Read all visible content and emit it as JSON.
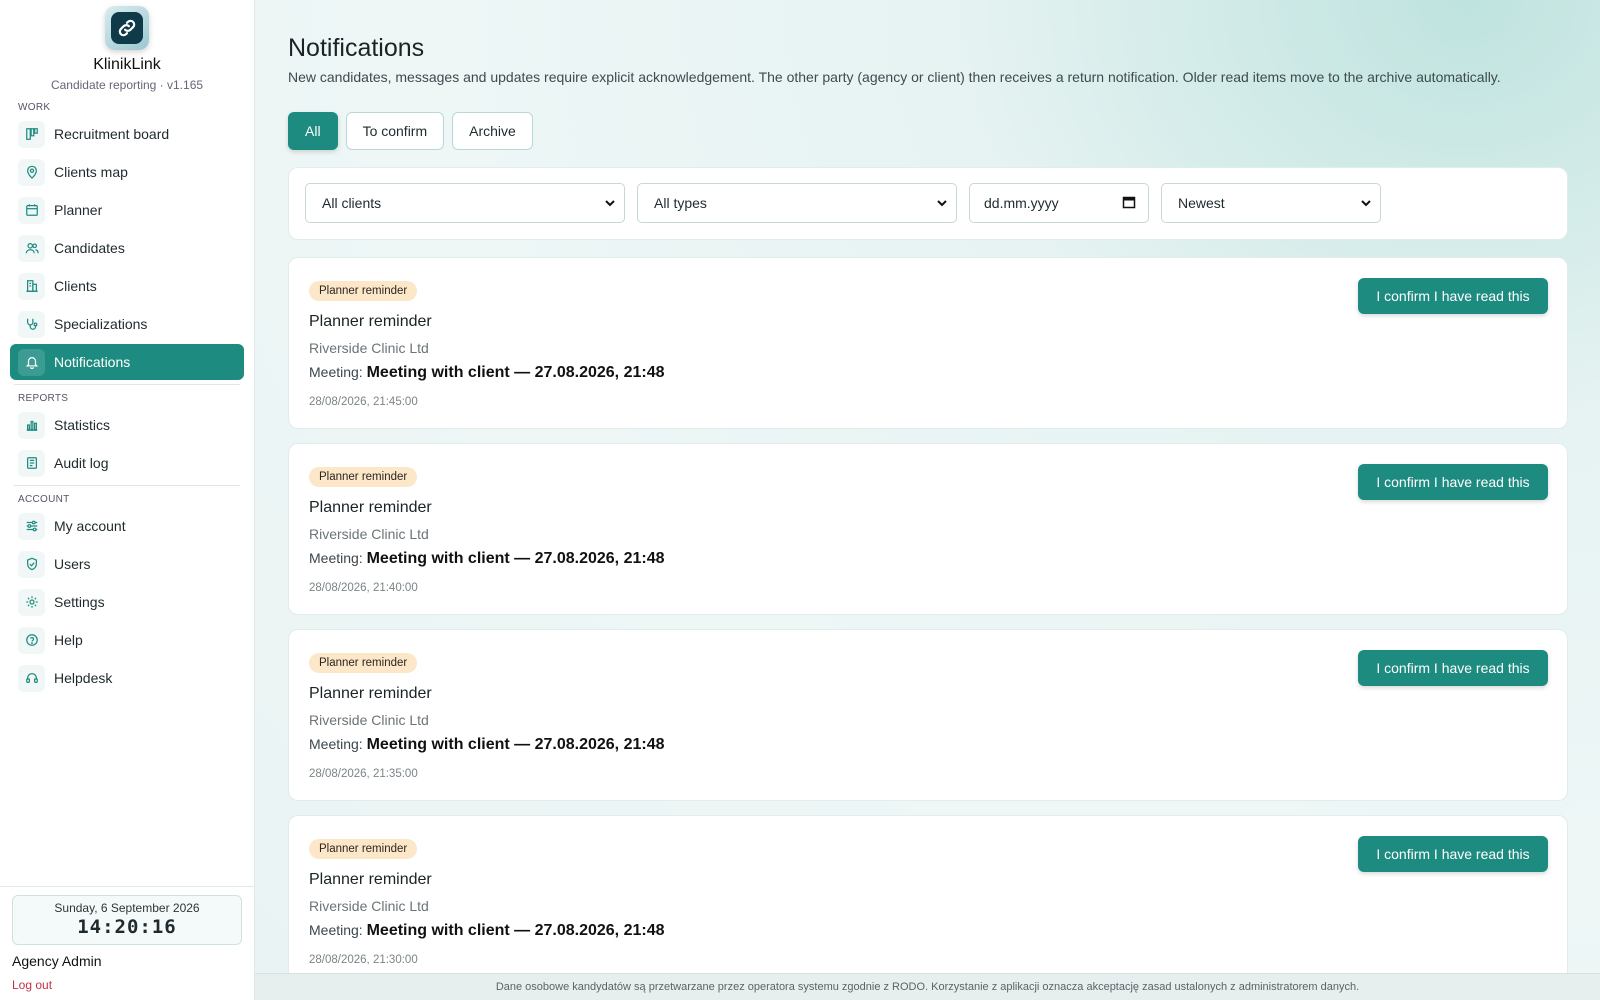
{
  "brand": {
    "name": "KlinikLink",
    "subtitle": "Candidate reporting · v1.165"
  },
  "sidebar": {
    "sections": {
      "work": "WORK",
      "reports": "REPORTS",
      "account": "ACCOUNT"
    },
    "items": [
      {
        "label": "Recruitment board",
        "icon": "board-icon"
      },
      {
        "label": "Clients map",
        "icon": "map-pin-icon"
      },
      {
        "label": "Planner",
        "icon": "calendar-icon"
      },
      {
        "label": "Candidates",
        "icon": "users-icon"
      },
      {
        "label": "Clients",
        "icon": "building-icon"
      },
      {
        "label": "Specializations",
        "icon": "stethoscope-icon"
      },
      {
        "label": "Notifications",
        "icon": "bell-icon",
        "active": true
      },
      {
        "label": "Statistics",
        "icon": "bar-chart-icon"
      },
      {
        "label": "Audit log",
        "icon": "audit-icon"
      },
      {
        "label": "My account",
        "icon": "sliders-icon"
      },
      {
        "label": "Users",
        "icon": "shield-icon"
      },
      {
        "label": "Settings",
        "icon": "gear-icon"
      },
      {
        "label": "Help",
        "icon": "help-icon"
      },
      {
        "label": "Helpdesk",
        "icon": "headset-icon"
      }
    ],
    "clock": {
      "date": "Sunday, 6 September 2026",
      "time": "14:20:16"
    },
    "user": "Agency Admin",
    "logout": "Log out"
  },
  "page": {
    "title": "Notifications",
    "description": "New candidates, messages and updates require explicit acknowledgement. The other party (agency or client) then receives a return notification. Older read items move to the archive automatically."
  },
  "tabs": [
    {
      "label": "All",
      "active": true
    },
    {
      "label": "To confirm"
    },
    {
      "label": "Archive"
    }
  ],
  "filters": {
    "client": "All clients",
    "type": "All types",
    "date_placeholder": "dd.mm.yyyy",
    "sort": "Newest"
  },
  "notifications": [
    {
      "badge": "Planner reminder",
      "title": "Planner reminder",
      "client": "Riverside Clinic Ltd",
      "meeting_label": "Meeting:",
      "meeting": "Meeting with client — 27.08.2026, 21:48",
      "timestamp": "28/08/2026, 21:45:00",
      "action": "I confirm I have read this"
    },
    {
      "badge": "Planner reminder",
      "title": "Planner reminder",
      "client": "Riverside Clinic Ltd",
      "meeting_label": "Meeting:",
      "meeting": "Meeting with client — 27.08.2026, 21:48",
      "timestamp": "28/08/2026, 21:40:00",
      "action": "I confirm I have read this"
    },
    {
      "badge": "Planner reminder",
      "title": "Planner reminder",
      "client": "Riverside Clinic Ltd",
      "meeting_label": "Meeting:",
      "meeting": "Meeting with client — 27.08.2026, 21:48",
      "timestamp": "28/08/2026, 21:35:00",
      "action": "I confirm I have read this"
    },
    {
      "badge": "Planner reminder",
      "title": "Planner reminder",
      "client": "Riverside Clinic Ltd",
      "meeting_label": "Meeting:",
      "meeting": "Meeting with client — 27.08.2026, 21:48",
      "timestamp": "28/08/2026, 21:30:00",
      "action": "I confirm I have read this"
    }
  ],
  "footer": "Dane osobowe kandydatów są przetwarzane przez operatora systemu zgodnie z RODO. Korzystanie z aplikacji oznacza akceptację zasad ustalonych z administratorem danych.",
  "colors": {
    "accent": "#1d8b80",
    "badge_bg": "#fde7c9",
    "logout": "#c2334a"
  }
}
